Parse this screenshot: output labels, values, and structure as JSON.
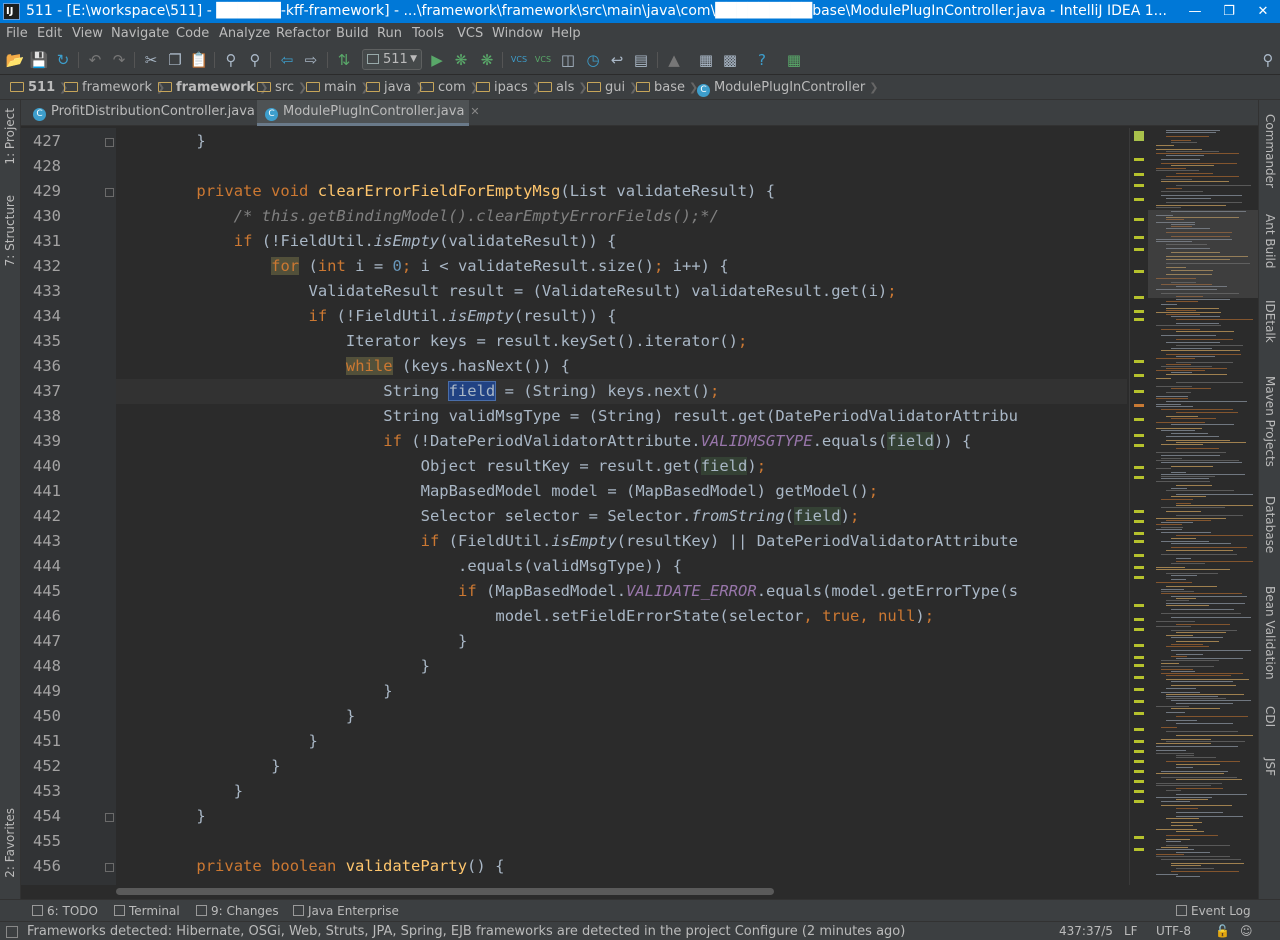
{
  "window": {
    "title": "511 - [E:\\workspace\\511] - ██████-kff-framework] - ...\\framework\\framework\\src\\main\\java\\com\\█████████base\\ModulePlugInController.java - IntelliJ IDEA 1..."
  },
  "menu": [
    "File",
    "Edit",
    "View",
    "Navigate",
    "Code",
    "Analyze",
    "Refactor",
    "Build",
    "Run",
    "Tools",
    "VCS",
    "Window",
    "Help"
  ],
  "toolbar": {
    "run_config": "511"
  },
  "breadcrumbs": [
    {
      "label": "511",
      "kind": "project"
    },
    {
      "label": "framework",
      "kind": "folder"
    },
    {
      "label": "framework",
      "kind": "module"
    },
    {
      "label": "src",
      "kind": "folder"
    },
    {
      "label": "main",
      "kind": "folder"
    },
    {
      "label": "java",
      "kind": "folder"
    },
    {
      "label": "com",
      "kind": "folder"
    },
    {
      "label": "ipacs",
      "kind": "folder"
    },
    {
      "label": "als",
      "kind": "folder"
    },
    {
      "label": "gui",
      "kind": "folder"
    },
    {
      "label": "base",
      "kind": "folder"
    },
    {
      "label": "ModulePlugInController",
      "kind": "class"
    }
  ],
  "tabs": [
    {
      "label": "ProfitDistributionController.java",
      "active": false
    },
    {
      "label": "ModulePlugInController.java",
      "active": true
    }
  ],
  "left_tool_tabs": [
    "1: Project",
    "7: Structure",
    "2: Favorites"
  ],
  "right_tool_tabs": [
    "Commander",
    "Ant Build",
    "IDEtalk",
    "Maven Projects",
    "Database",
    "Bean Validation",
    "CDI",
    "JSF"
  ],
  "editor": {
    "caret_line": 437,
    "lines": [
      {
        "n": "427",
        "text": "    }"
      },
      {
        "n": "428",
        "text": ""
      },
      {
        "n": "429",
        "text": "    private void clearErrorFieldForEmptyMsg(List validateResult) {"
      },
      {
        "n": "430",
        "text": "        /* this.getBindingModel().clearEmptyErrorFields();*/"
      },
      {
        "n": "431",
        "text": "        if (!FieldUtil.isEmpty(validateResult)) {"
      },
      {
        "n": "432",
        "text": "            for (int i = 0; i < validateResult.size(); i++) {"
      },
      {
        "n": "433",
        "text": "                ValidateResult result = (ValidateResult) validateResult.get(i);"
      },
      {
        "n": "434",
        "text": "                if (!FieldUtil.isEmpty(result)) {"
      },
      {
        "n": "435",
        "text": "                    Iterator keys = result.keySet().iterator();"
      },
      {
        "n": "436",
        "text": "                    while (keys.hasNext()) {"
      },
      {
        "n": "437",
        "text": "                        String field = (String) keys.next();"
      },
      {
        "n": "438",
        "text": "                        String validMsgType = (String) result.get(DatePeriodValidatorAttribu"
      },
      {
        "n": "439",
        "text": "                        if (!DatePeriodValidatorAttribute.VALIDMSGTYPE.equals(field)) {"
      },
      {
        "n": "440",
        "text": "                            Object resultKey = result.get(field);"
      },
      {
        "n": "441",
        "text": "                            MapBasedModel model = (MapBasedModel) getModel();"
      },
      {
        "n": "442",
        "text": "                            Selector selector = Selector.fromString(field);"
      },
      {
        "n": "443",
        "text": "                            if (FieldUtil.isEmpty(resultKey) || DatePeriodValidatorAttribute"
      },
      {
        "n": "444",
        "text": "                                .equals(validMsgType)) {"
      },
      {
        "n": "445",
        "text": "                                if (MapBasedModel.VALIDATE_ERROR.equals(model.getErrorType(s"
      },
      {
        "n": "446",
        "text": "                                    model.setFieldErrorState(selector, true, null);"
      },
      {
        "n": "447",
        "text": "                                }"
      },
      {
        "n": "448",
        "text": "                            }"
      },
      {
        "n": "449",
        "text": "                        }"
      },
      {
        "n": "450",
        "text": "                    }"
      },
      {
        "n": "451",
        "text": "                }"
      },
      {
        "n": "452",
        "text": "            }"
      },
      {
        "n": "453",
        "text": "        }"
      },
      {
        "n": "454",
        "text": "    }"
      },
      {
        "n": "455",
        "text": ""
      },
      {
        "n": "456",
        "text": "    private boolean validateParty() {"
      }
    ]
  },
  "tool_windows": [
    {
      "label": "6: TODO"
    },
    {
      "label": "Terminal"
    },
    {
      "label": "9: Changes"
    },
    {
      "label": "Java Enterprise"
    },
    {
      "label": "Event Log"
    }
  ],
  "status": {
    "message": "Frameworks detected: Hibernate, OSGi, Web, Struts, JPA, Spring, EJB frameworks are detected in the project Configure (2 minutes ago)",
    "position": "437:37/5",
    "line_separator": "LF",
    "encoding": "UTF-8"
  },
  "colors": {
    "keyword": "#cc7832",
    "method": "#ffc66d",
    "comment": "#808080",
    "number": "#6897bb",
    "constant": "#9876aa",
    "plain": "#a9b7c6",
    "background": "#2b2b2b",
    "titlebar": "#0078d7"
  }
}
